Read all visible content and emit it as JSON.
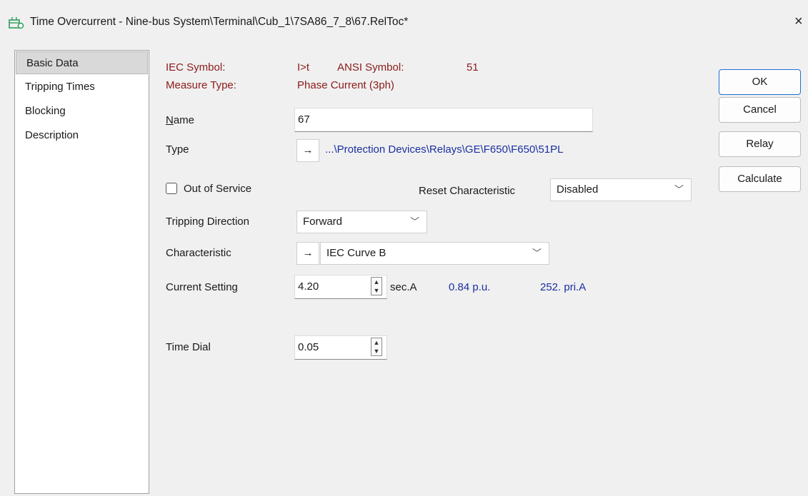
{
  "window": {
    "title": "Time Overcurrent - Nine-bus System\\Terminal\\Cub_1\\7SA86_7_8\\67.RelToc*",
    "close_glyph": "×"
  },
  "nav": {
    "items": [
      {
        "label": "Basic Data",
        "selected": true
      },
      {
        "label": "Tripping Times"
      },
      {
        "label": "Blocking"
      },
      {
        "label": "Description"
      }
    ]
  },
  "header": {
    "iec_symbol_label": "IEC Symbol:",
    "iec_symbol_value": "I>t",
    "ansi_symbol_label": "ANSI Symbol:",
    "ansi_symbol_value": "51",
    "measure_type_label": "Measure Type:",
    "measure_type_value": "Phase Current (3ph)"
  },
  "form": {
    "name_label_accel": "N",
    "name_label_rest": "ame",
    "name_value": "67",
    "type_label": "Type",
    "type_arrow": "→",
    "type_value": "...\\Protection Devices\\Relays\\GE\\F650\\F650\\51PL",
    "out_of_service_label": "Out of Service",
    "out_of_service_checked": false,
    "reset_characteristic_label": "Reset Characteristic",
    "reset_characteristic_value": "Disabled",
    "tripping_direction_label": "Tripping Direction",
    "tripping_direction_value": "Forward",
    "characteristic_label": "Characteristic",
    "characteristic_arrow": "→",
    "characteristic_value": "IEC Curve B",
    "current_setting_label": "Current Setting",
    "current_setting_value": "4.20",
    "current_setting_unit": "sec.A",
    "current_setting_pu": "0.84 p.u.",
    "current_setting_pri": "252. pri.A",
    "time_dial_label": "Time Dial",
    "time_dial_value": "0.05"
  },
  "buttons": {
    "ok": "OK",
    "cancel": "Cancel",
    "relay": "Relay",
    "calculate": "Calculate"
  },
  "icons": {
    "chevron": "﹀",
    "spin_up": "▲",
    "spin_down": "▼"
  },
  "colors": {
    "label_dark_red": "#8b1a1a",
    "link_blue": "#1a2fa0",
    "ok_border": "#1f6fd1",
    "title_icon": "#2e9d5a"
  }
}
